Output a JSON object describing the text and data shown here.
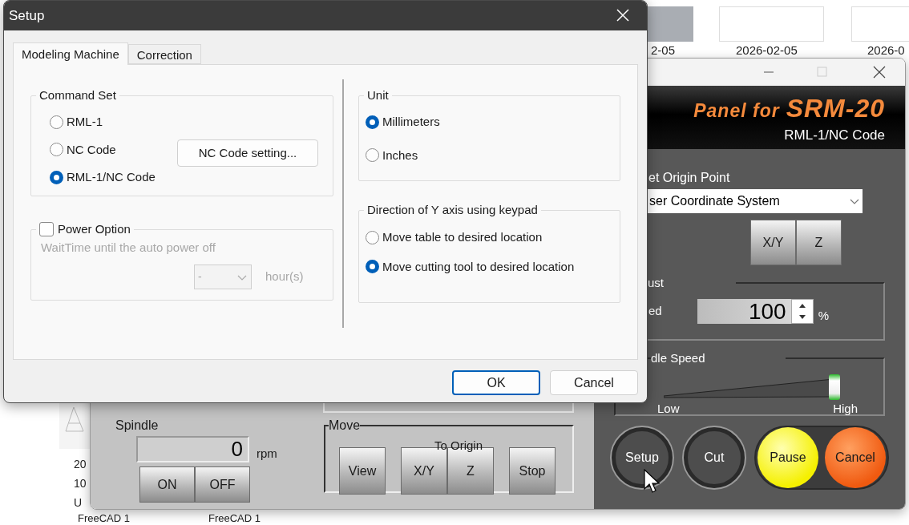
{
  "desktop": {
    "date_labels": [
      "2-05",
      "2026-02-05",
      "2026-0"
    ],
    "file_lines": [
      "20",
      "10",
      "U"
    ],
    "file_names": [
      "FreeCAD 1",
      "FreeCAD 1"
    ]
  },
  "control_panel": {
    "banner": {
      "prefix": "Panel for",
      "model": "SRM-20",
      "subtitle": "RML-1/NC Code"
    },
    "origin_label": "et Origin Point",
    "origin_select": "ser Coordinate System",
    "origin_buttons": [
      "X/Y",
      "Z"
    ],
    "speed_group": "ust",
    "speed_label": "ed",
    "speed_value": "100",
    "speed_unit": "%",
    "spindle_group": "dle Speed",
    "spindle_slider": {
      "level": 1,
      "min_label": "Low",
      "max_label": "High"
    },
    "actions": [
      {
        "label": "Setup",
        "kind": "ring"
      },
      {
        "label": "Cut",
        "kind": "ring"
      },
      {
        "label": "Pause",
        "kind": "pause"
      },
      {
        "label": "Cancel",
        "kind": "cancel"
      }
    ],
    "spindle": {
      "label": "Spindle",
      "value": "0",
      "unit": "rpm",
      "buttons": [
        "ON",
        "OFF"
      ]
    },
    "move": {
      "label": "Move",
      "to_origin": "To Origin",
      "buttons": [
        {
          "label": "View",
          "kind": "single"
        },
        {
          "label": "X/Y",
          "kind": "origin"
        },
        {
          "label": "Z",
          "kind": "origin"
        },
        {
          "label": "Stop",
          "kind": "single"
        }
      ]
    }
  },
  "dialog": {
    "title": "Setup",
    "tabs": [
      {
        "label": "Modeling Machine",
        "selected": true
      },
      {
        "label": "Correction",
        "selected": false
      }
    ],
    "command_set": {
      "label": "Command Set",
      "options": [
        {
          "label": "RML-1",
          "selected": false
        },
        {
          "label": "NC Code",
          "selected": false
        },
        {
          "label": "RML-1/NC Code",
          "selected": true
        }
      ],
      "setting_button": "NC Code setting..."
    },
    "power_option": {
      "label": "Power Option",
      "checked": false,
      "hint": "WaitTime until the auto power off",
      "select_value": "-",
      "unit": "hour(s)"
    },
    "unit": {
      "label": "Unit",
      "options": [
        {
          "label": "Millimeters",
          "selected": true
        },
        {
          "label": "Inches",
          "selected": false
        }
      ]
    },
    "y_direction": {
      "label": "Direction of Y axis using keypad",
      "options": [
        {
          "label": "Move table to desired location",
          "selected": false
        },
        {
          "label": "Move cutting tool to desired location",
          "selected": true
        }
      ]
    },
    "buttons": [
      {
        "label": "OK",
        "default": true
      },
      {
        "label": "Cancel",
        "default": false
      }
    ]
  }
}
